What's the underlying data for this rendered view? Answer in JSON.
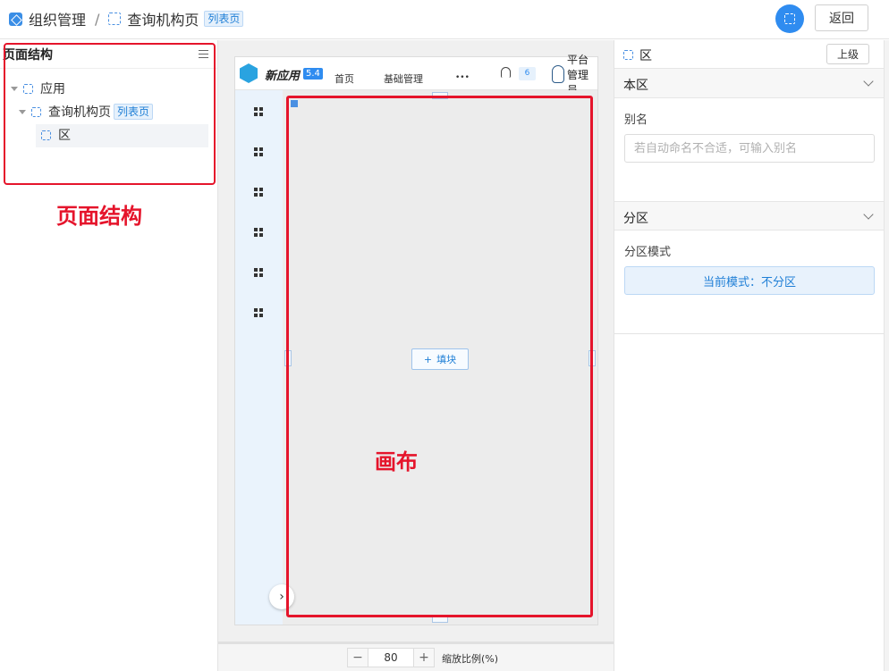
{
  "header": {
    "breadcrumb_root": "组织管理",
    "separator": "/",
    "page_name": "查询机构页",
    "page_tag": "列表页",
    "back_label": "返回"
  },
  "left_panel": {
    "title": "页面结构",
    "tree": [
      {
        "label": "应用"
      },
      {
        "label": "查询机构页",
        "tag": "列表页"
      },
      {
        "label": "区"
      }
    ],
    "annotation": "页面结构"
  },
  "canvas": {
    "app_name": "新应用",
    "version": "5.4",
    "nav": [
      "首页",
      "基础管理",
      "•••"
    ],
    "notify_count": "6",
    "user_name": "平台管理员",
    "fill_label": "填块",
    "annotation": "画布",
    "zoom_minus": "−",
    "zoom_value": "80",
    "zoom_plus": "+",
    "zoom_label": "缩放比例(%)",
    "expand_symbol": "›"
  },
  "right_panel": {
    "title": "区",
    "up_label": "上级",
    "section1_title": "本区",
    "alias_label": "别名",
    "alias_placeholder": "若自动命名不合适，可输入别名",
    "section2_title": "分区",
    "partition_label": "分区模式",
    "partition_value": "当前模式：不分区"
  },
  "colors": {
    "accent": "#2f8cf0",
    "annotation_red": "#e5142b",
    "tag_bg": "#e6f1fc"
  }
}
